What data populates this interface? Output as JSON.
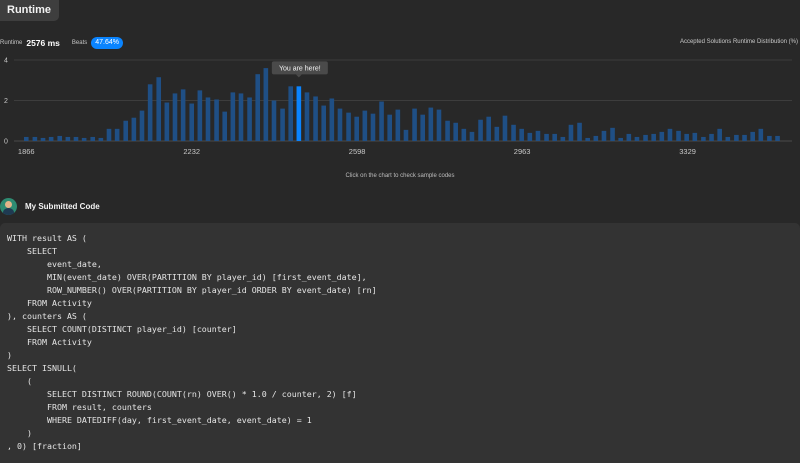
{
  "header": {
    "tab_label": "Runtime"
  },
  "stats": {
    "runtime_label": "Runtime",
    "runtime_value": "2576 ms",
    "beats_label": "Beats",
    "beats_value": "47.64%"
  },
  "chart_data": {
    "type": "bar",
    "title": "Accepted Solutions Runtime Distribution (%)",
    "x_tick_labels": [
      "1866",
      "2232",
      "2598",
      "2963",
      "3329"
    ],
    "y_tick_labels": [
      "0",
      "2",
      "4"
    ],
    "ylim": [
      0,
      4
    ],
    "xlim": [
      1830,
      3560
    ],
    "grid": true,
    "highlight_index": 33,
    "tooltip": "You are here!",
    "bar_color": "#1f4f85",
    "highlight_color": "#0a84ff",
    "x": [
      1866,
      1885,
      1903,
      1921,
      1940,
      1958,
      1976,
      1994,
      2013,
      2031,
      2049,
      2067,
      2086,
      2104,
      2122,
      2140,
      2159,
      2177,
      2195,
      2213,
      2232,
      2250,
      2268,
      2287,
      2305,
      2323,
      2341,
      2360,
      2378,
      2396,
      2414,
      2433,
      2451,
      2469,
      2487,
      2506,
      2524,
      2542,
      2560,
      2579,
      2597,
      2615,
      2633,
      2652,
      2670,
      2688,
      2706,
      2725,
      2743,
      2761,
      2779,
      2798,
      2816,
      2834,
      2852,
      2871,
      2889,
      2907,
      2925,
      2944,
      2962,
      2980,
      2998,
      3017,
      3035,
      3053,
      3071,
      3090,
      3108,
      3126,
      3144,
      3163,
      3181,
      3199,
      3217,
      3236,
      3254,
      3272,
      3290,
      3309,
      3327,
      3345,
      3364,
      3382,
      3400,
      3418,
      3437,
      3455,
      3473,
      3491,
      3510,
      3528
    ],
    "values": [
      0.2,
      0.2,
      0.15,
      0.2,
      0.25,
      0.2,
      0.2,
      0.15,
      0.2,
      0.15,
      0.6,
      0.6,
      1.0,
      1.15,
      1.5,
      2.8,
      3.15,
      1.9,
      2.35,
      2.55,
      1.85,
      2.5,
      2.15,
      2.05,
      1.45,
      2.4,
      2.35,
      2.15,
      3.3,
      3.6,
      2.0,
      1.6,
      2.7,
      2.7,
      2.4,
      2.2,
      1.75,
      2.1,
      1.6,
      1.4,
      1.2,
      1.5,
      1.35,
      1.95,
      1.3,
      1.55,
      0.55,
      1.6,
      1.3,
      1.65,
      1.55,
      1.0,
      0.9,
      0.6,
      0.45,
      1.05,
      1.2,
      0.7,
      1.25,
      0.8,
      0.6,
      0.4,
      0.5,
      0.35,
      0.35,
      0.2,
      0.8,
      0.9,
      0.15,
      0.25,
      0.5,
      0.65,
      0.15,
      0.35,
      0.2,
      0.3,
      0.35,
      0.45,
      0.6,
      0.5,
      0.35,
      0.4,
      0.2,
      0.35,
      0.6,
      0.2,
      0.3,
      0.3,
      0.45,
      0.6,
      0.25,
      0.25
    ]
  },
  "chart_hint": "Click on the chart to check sample codes",
  "submission": {
    "title": "My Submitted Code",
    "code": "WITH result AS (\n    SELECT\n        event_date,\n        MIN(event_date) OVER(PARTITION BY player_id) [first_event_date],\n        ROW_NUMBER() OVER(PARTITION BY player_id ORDER BY event_date) [rn]\n    FROM Activity\n), counters AS (\n    SELECT COUNT(DISTINCT player_id) [counter]\n    FROM Activity\n)\nSELECT ISNULL(\n    (\n        SELECT DISTINCT ROUND(COUNT(rn) OVER() * 1.0 / counter, 2) [f]\n        FROM result, counters\n        WHERE DATEDIFF(day, first_event_date, event_date) = 1\n    )\n, 0) [fraction]"
  }
}
